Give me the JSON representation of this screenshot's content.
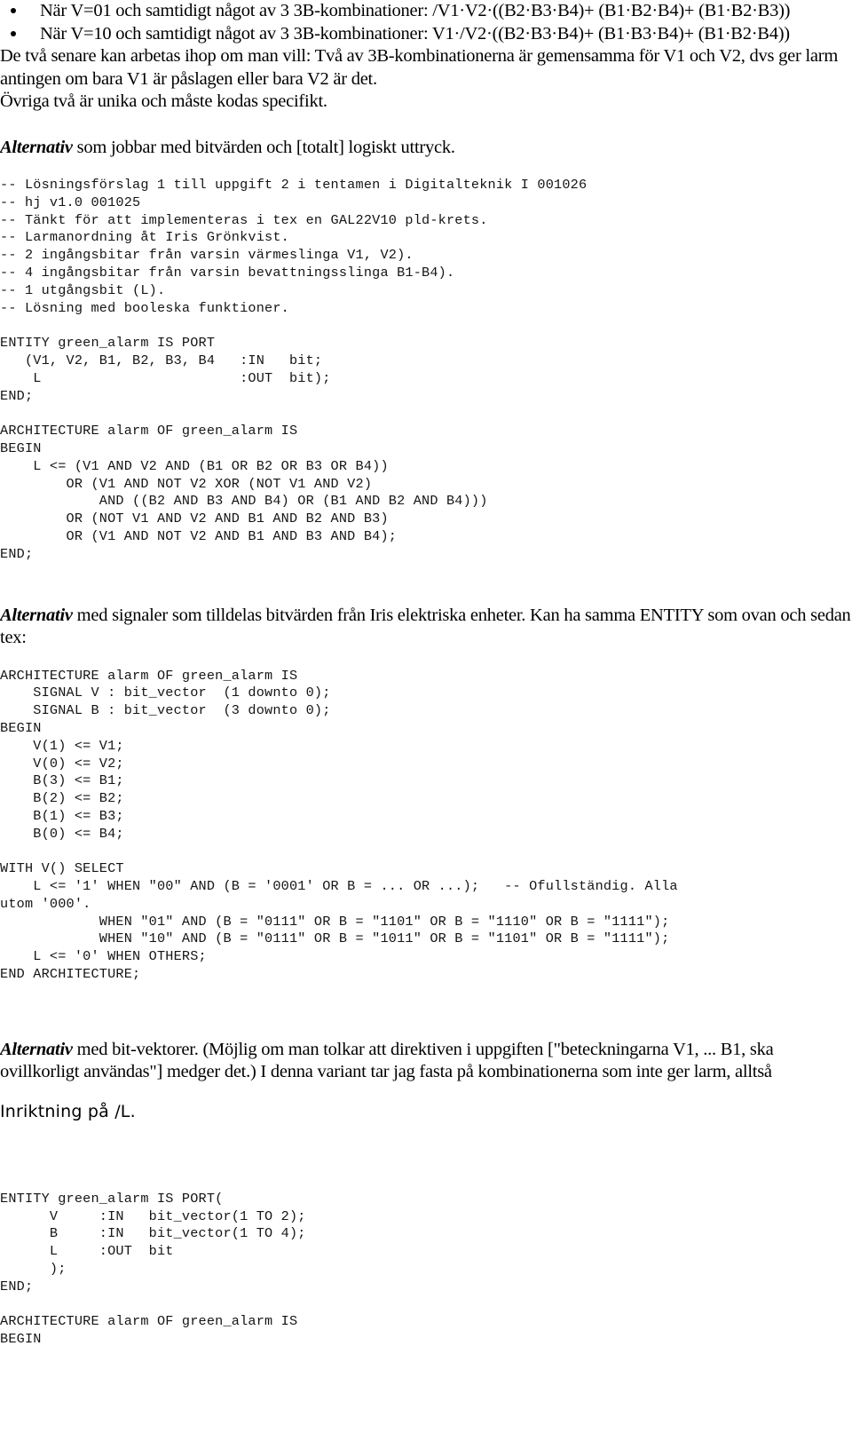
{
  "document": {
    "language": "sv",
    "bullets": [
      "När V=01 och samtidigt något av 3 3B-kombinationer: /V1·V2·((B2·B3·B4)+ (B1·B2·B4)+ (B1·B2·B3))",
      "När V=10 och samtidigt något av 3 3B-kombinationer: V1·/V2·((B2·B3·B4)+ (B1·B3·B4)+ (B1·B2·B4))"
    ],
    "paragraph_after_bullets": "De två senare kan arbetas ihop om man vill: Två av 3B-kombinationerna är gemensamma för V1 och V2, dvs ger larm antingen om bara V1 är påslagen eller bara V2 är det.",
    "paragraph_unique": "Övriga två är unika och måste kodas specifikt.",
    "section1": {
      "heading_bold": "Alternativ",
      "heading_rest": " som jobbar med bitvärden och [totalt] logiskt uttryck.",
      "code": "-- Lösningsförslag 1 till uppgift 2 i tentamen i Digitalteknik I 001026\n-- hj v1.0 001025\n-- Tänkt för att implementeras i tex en GAL22V10 pld-krets.\n-- Larmanordning åt Iris Grönkvist.\n-- 2 ingångsbitar från varsin värmeslinga V1, V2).\n-- 4 ingångsbitar från varsin bevattningsslinga B1-B4).\n-- 1 utgångsbit (L).\n-- Lösning med booleska funktioner.\n\nENTITY green_alarm IS PORT\n   (V1, V2, B1, B2, B3, B4   :IN   bit;\n    L                        :OUT  bit);\nEND;\n\nARCHITECTURE alarm OF green_alarm IS\nBEGIN\n    L <= (V1 AND V2 AND (B1 OR B2 OR B3 OR B4))\n        OR (V1 AND NOT V2 XOR (NOT V1 AND V2)\n            AND ((B2 AND B3 AND B4) OR (B1 AND B2 AND B4)))\n        OR (NOT V1 AND V2 AND B1 AND B2 AND B3)\n        OR (V1 AND NOT V2 AND B1 AND B3 AND B4);\nEND;"
    },
    "section2": {
      "heading_bold": "Alternativ",
      "heading_rest": " med signaler som tilldelas bitvärden från Iris elektriska enheter. Kan ha samma ENTITY som ovan och sedan tex:",
      "code": "ARCHITECTURE alarm OF green_alarm IS\n    SIGNAL V : bit_vector  (1 downto 0);\n    SIGNAL B : bit_vector  (3 downto 0);\nBEGIN\n    V(1) <= V1;\n    V(0) <= V2;\n    B(3) <= B1;\n    B(2) <= B2;\n    B(1) <= B3;\n    B(0) <= B4;\n\nWITH V() SELECT\n    L <= '1' WHEN \"00\" AND (B = '0001' OR B = ... OR ...);   -- Ofullständig. Alla\nutom '000'.\n            WHEN \"01\" AND (B = \"0111\" OR B = \"1101\" OR B = \"1110\" OR B = \"1111\");\n            WHEN \"10\" AND (B = \"0111\" OR B = \"1011\" OR B = \"1101\" OR B = \"1111\");\n    L <= '0' WHEN OTHERS;\nEND ARCHITECTURE;"
    },
    "section3": {
      "heading_bold": "Alternativ",
      "heading_rest": " med bit-vektorer. (Möjlig om man tolkar att direktiven i uppgiften [\"beteckningarna V1, ... B1, ska ovillkorligt användas\"] medger det.) I denna variant tar jag fasta på kombinationerna som inte ger larm, alltså",
      "note": "Inriktning på /L.",
      "code": "ENTITY green_alarm IS PORT(\n      V     :IN   bit_vector(1 TO 2);\n      B     :IN   bit_vector(1 TO 4);\n      L     :OUT  bit\n      );\nEND;\n\nARCHITECTURE alarm OF green_alarm IS\nBEGIN"
    }
  }
}
